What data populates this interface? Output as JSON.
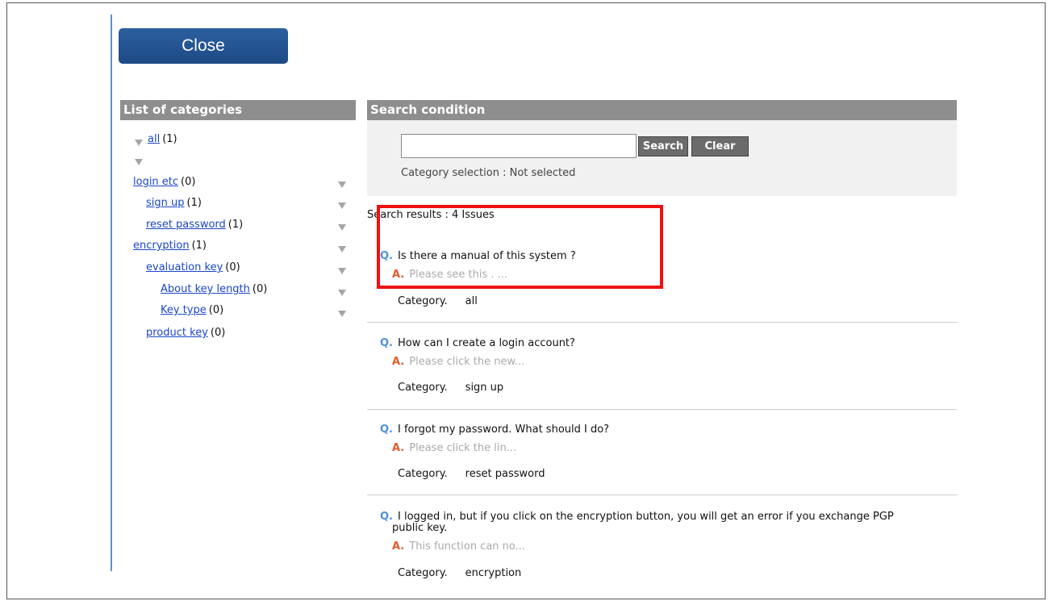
{
  "close_button": {
    "label": "Close"
  },
  "categories": {
    "title": "List of categories",
    "items": [
      {
        "label": "all",
        "count": "(1)"
      },
      {
        "label": "login etc",
        "count": "(0)"
      },
      {
        "label": "sign up",
        "count": "(1)"
      },
      {
        "label": "reset password",
        "count": "(1)"
      },
      {
        "label": "encryption",
        "count": "(1)"
      },
      {
        "label": "evaluation key",
        "count": "(0)"
      },
      {
        "label": "About key length",
        "count": "(0)"
      },
      {
        "label": "Key type",
        "count": "(0)"
      },
      {
        "label": "product key",
        "count": "(0)"
      }
    ]
  },
  "search": {
    "title": "Search condition",
    "input_value": "",
    "search_label": "Search",
    "clear_label": "Clear",
    "category_selection": "Category selection :  Not selected"
  },
  "results": {
    "label": "Search results :  4 Issues",
    "q_marker": "Q.",
    "a_marker": "A.",
    "category_prefix": "Category.",
    "items": [
      {
        "question": "Is there a manual of this system ?",
        "answer": "Please see this .  ...",
        "category": "all"
      },
      {
        "question": "How can I create a login account?",
        "answer": "Please click the new...",
        "category": "sign up"
      },
      {
        "question": "I forgot my password. What should I do?",
        "answer": "Please click the lin...",
        "category": "reset password"
      },
      {
        "question": "I logged in, but if you click on the encryption button, you will get an error if you exchange PGP",
        "question_line2": "public key.",
        "answer": "This function can no...",
        "category": "encryption"
      }
    ]
  },
  "colors": {
    "accent": "#1d4a85",
    "link": "#1a46c9",
    "highlight": "#ee1111",
    "q_marker": "#4a90d9",
    "a_marker": "#e35b2f"
  }
}
